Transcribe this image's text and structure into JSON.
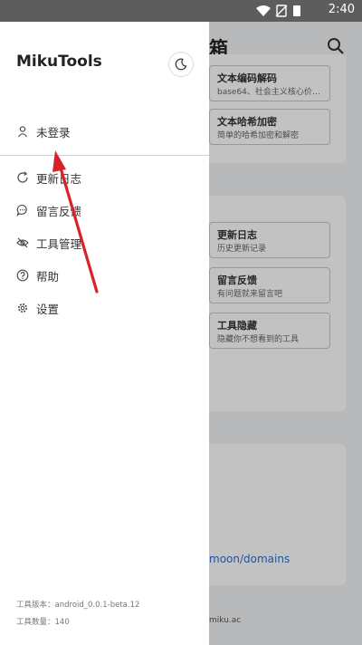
{
  "status_bar": {
    "time": "2:40"
  },
  "background": {
    "title_fragment": "箱",
    "tools": [
      {
        "title": "文本编码解码",
        "desc": "base64、社会主义核心价…"
      },
      {
        "title": "文本哈希加密",
        "desc": "简单的哈希加密和解密"
      }
    ],
    "links": [
      {
        "title": "更新日志",
        "desc": "历史更新记录"
      },
      {
        "title": "留言反馈",
        "desc": "有问题就来留言吧"
      },
      {
        "title": "工具隐藏",
        "desc": "隐藏你不想看到的工具"
      }
    ],
    "domain_link": "moon/domains",
    "footer_fragment": "miku.ac"
  },
  "drawer": {
    "app_name": "MikuTools",
    "login": "未登录",
    "menu": [
      "更新日志",
      "留言反馈",
      "工具管理",
      "帮助",
      "设置"
    ],
    "version_label": "工具版本：",
    "version": "android_0.0.1-beta.12",
    "count_label": "工具数量：",
    "count": "140"
  }
}
